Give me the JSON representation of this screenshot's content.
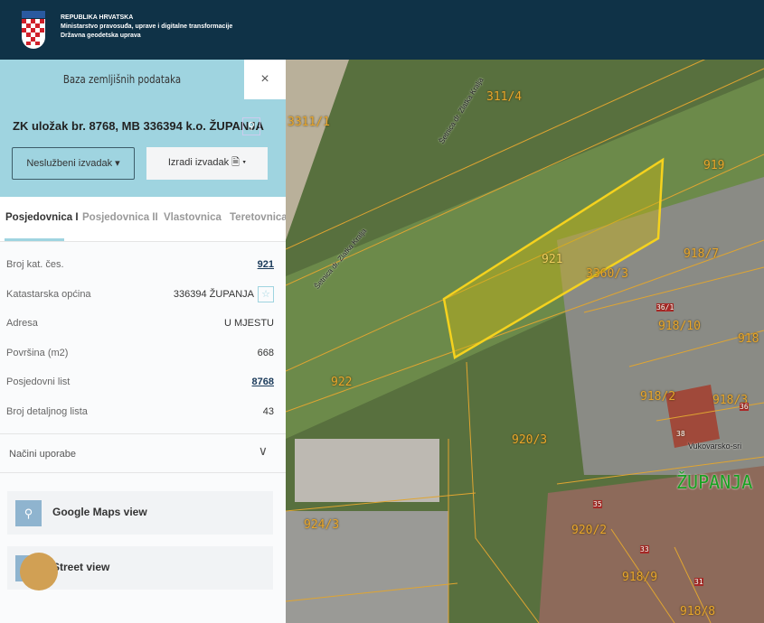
{
  "header": {
    "line1": "REPUBLIKA HRVATSKA",
    "line2": "Ministarstvo pravosuđa, uprave i digitalne transformacije",
    "line3": "Državna geodetska uprava"
  },
  "panel": {
    "title": "Baza zemljišnih podataka",
    "close": "×",
    "zk_title": "ZK uložak br. 8768, MB 336394 k.o. ŽUPANJA",
    "btn_unofficial": "Neslužbeni izvadak ▾",
    "btn_create": "Izradi izvadak 🗎 ▾"
  },
  "tabs": [
    "Posjedovnica I",
    "Posjedovnica II",
    "Vlastovnica",
    "Teretovnica"
  ],
  "rows": [
    {
      "label": "Broj kat. čes.",
      "value": "921"
    },
    {
      "label": "Katastarska općina",
      "value": "336394 ŽUPANJA"
    },
    {
      "label": "Adresa",
      "value": "U MJESTU"
    },
    {
      "label": "Površina (m2)",
      "value": "668"
    },
    {
      "label": "Posjedovni list",
      "value": "8768"
    },
    {
      "label": "Broj detaljnog lista",
      "value": "43"
    }
  ],
  "accordion": {
    "label": "Načini uporabe"
  },
  "links": {
    "google": "Google Maps view",
    "street": "Street view"
  },
  "map": {
    "labels": [
      "3311/1",
      "311/4",
      "919",
      "921",
      "918/7",
      "3360/3",
      "36/1",
      "918/10",
      "918",
      "922",
      "918/2",
      "918/3",
      "36",
      "38",
      "Vukovarsko-sri",
      "920/3",
      "ŽUPANJA",
      "35",
      "924/3",
      "920/2",
      "33",
      "918/9",
      "31",
      "918/8"
    ],
    "street": "Šetnica dr. Zlatka Kralja"
  }
}
